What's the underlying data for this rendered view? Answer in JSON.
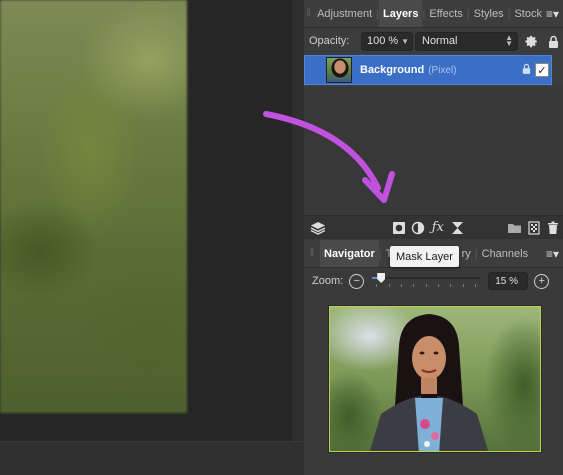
{
  "layers_panel": {
    "tabs": [
      {
        "label": "Adjustment",
        "active": false
      },
      {
        "label": "Layers",
        "active": true
      },
      {
        "label": "Effects",
        "active": false
      },
      {
        "label": "Styles",
        "active": false
      },
      {
        "label": "Stock",
        "active": false
      }
    ],
    "opacity_label": "Opacity:",
    "opacity_value": "100 %",
    "blend_mode": "Normal",
    "layers": [
      {
        "name": "Background",
        "type": "(Pixel)",
        "locked": true,
        "visible": true
      }
    ],
    "toolbar_icons": [
      "layers-stack-icon",
      "mask-layer-icon",
      "adjustment-icon",
      "fx-icon",
      "hourglass-icon",
      "folder-icon",
      "add-pixel-layer-icon",
      "trash-icon"
    ]
  },
  "navigator_panel": {
    "tabs": [
      {
        "label": "Navigator",
        "active": true
      },
      {
        "label": "Tr",
        "active": false
      },
      {
        "label": "ry",
        "active": false
      },
      {
        "label": "Channels",
        "active": false
      }
    ],
    "zoom_label": "Zoom:",
    "zoom_value": "15 %",
    "zoom_fraction": 0.08
  },
  "tooltip": {
    "text": "Mask Layer"
  },
  "annotation": {
    "arrow_color": "#c152e0"
  },
  "colors": {
    "selection": "#3b6fc6",
    "panel_bg": "#3a3a3a",
    "canvas_bg": "#262626"
  }
}
